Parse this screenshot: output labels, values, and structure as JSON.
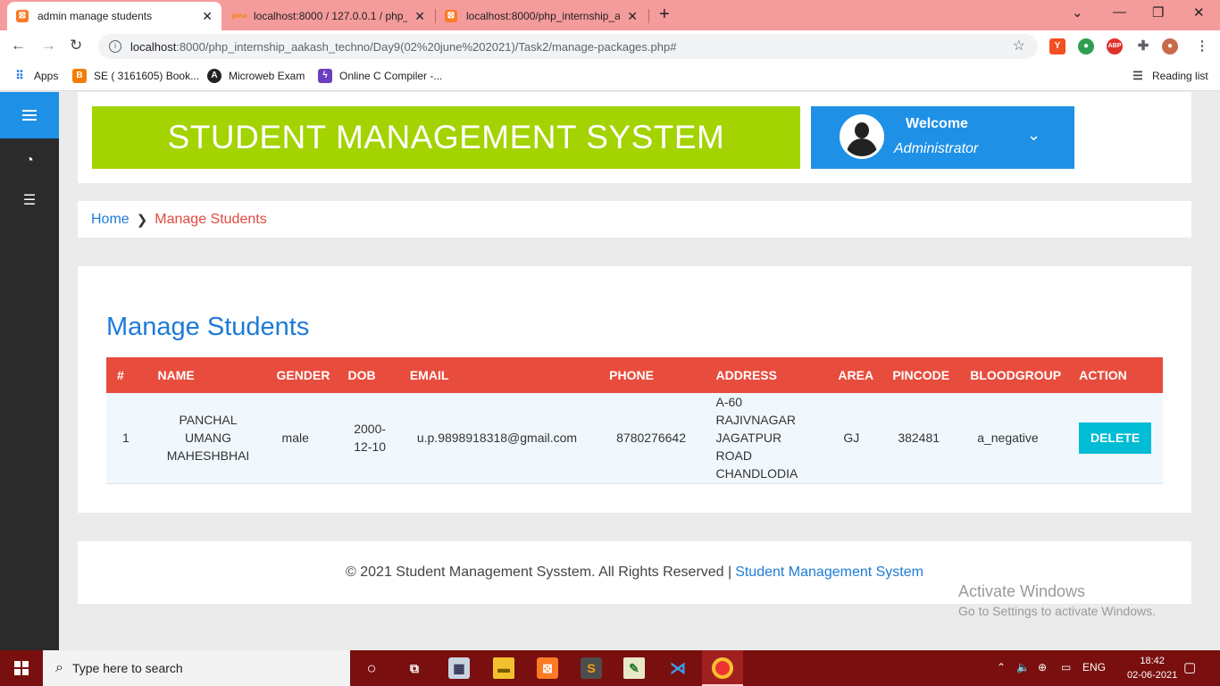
{
  "browser": {
    "tabs": [
      {
        "title": "admin manage students",
        "active": true,
        "close": "✕"
      },
      {
        "title": "localhost:8000 / 127.0.0.1 / php_i",
        "active": false,
        "close": "✕"
      },
      {
        "title": "localhost:8000/php_internship_aa",
        "active": false,
        "close": "✕"
      }
    ],
    "new_tab": "+",
    "url_host": "localhost",
    "url_path": ":8000/php_internship_aakash_techno/Day9(02%20june%202021)/Task2/manage-packages.php#",
    "bookmarks": [
      {
        "label": "Apps",
        "color": "#1a73e8"
      },
      {
        "label": "SE ( 3161605) Book...",
        "color": "#f57c00"
      },
      {
        "label": "Microweb Exam",
        "color": "#222222"
      },
      {
        "label": "Online C Compiler -...",
        "color": "#6a3fc1"
      }
    ],
    "reading_list": "Reading list"
  },
  "sidebar": {
    "items": [
      {
        "icon": "dashboard-icon"
      },
      {
        "icon": "list-icon"
      }
    ]
  },
  "header": {
    "banner_title": "STUDENT MANAGEMENT SYSTEM",
    "welcome": "Welcome",
    "role": "Administrator"
  },
  "breadcrumb": {
    "home": "Home",
    "current": "Manage Students"
  },
  "content": {
    "title": "Manage Students",
    "columns": [
      "#",
      "NAME",
      "GENDER",
      "DOB",
      "EMAIL",
      "PHONE",
      "ADDRESS",
      "AREA",
      "PINCODE",
      "BLOODGROUP",
      "ACTION"
    ],
    "rows": [
      {
        "num": "1",
        "name": "PANCHAL UMANG MAHESHBHAI",
        "gender": "male",
        "dob": "2000-12-10",
        "email": "u.p.9898918318@gmail.com",
        "phone": "8780276642",
        "address": "A-60 RAJIVNAGAR JAGATPUR ROAD CHANDLODIA",
        "area": "GJ",
        "pincode": "382481",
        "bloodgroup": "a_negative",
        "action": "DELETE"
      }
    ]
  },
  "footer": {
    "text": "© 2021 Student Management Sysstem. All Rights Reserved |",
    "link": "Student Management System"
  },
  "watermark": {
    "line1": "Activate Windows",
    "line2": "Go to Settings to activate Windows."
  },
  "taskbar": {
    "search_placeholder": "Type here to search",
    "lang": "ENG",
    "time": "18:42",
    "date": "02-06-2021"
  },
  "colors": {
    "banner": "#a3d300",
    "accent_blue": "#1e90e6",
    "table_header": "#e84c3d",
    "delete_button": "#00bcd4",
    "tab_bar": "#f49b9b",
    "taskbar": "#7a0f0f"
  }
}
